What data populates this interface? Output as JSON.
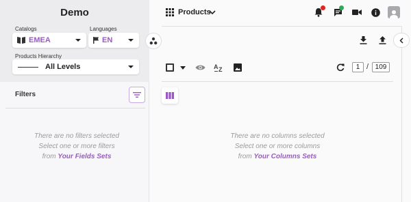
{
  "app": {
    "title": "Demo"
  },
  "catalogs": {
    "label": "Catalogs",
    "value": "EMEA"
  },
  "languages": {
    "label": "Languages",
    "value": "EN"
  },
  "hierarchy": {
    "label": "Products Hierarchy",
    "value": "All Levels"
  },
  "filters": {
    "label": "Filters",
    "empty_line1": "There are no filters selected",
    "empty_line2": "Select one or more filters",
    "empty_prefix": "from",
    "empty_link": "Your Fields Sets"
  },
  "header": {
    "products_label": "Products",
    "notification_badge_color": "#e02424",
    "chat_badge_color": "#2eaa5a"
  },
  "pagination": {
    "current": "1",
    "separator": "/",
    "total": "109"
  },
  "columns": {
    "empty_line1": "There are no columns selected",
    "empty_line2": "Select one or more columns",
    "empty_prefix": "from",
    "empty_link": "Your Columns Sets"
  },
  "colors": {
    "accent": "#9b59c8",
    "muted_text": "#9a9a9a"
  },
  "icons": [
    "apps-grid-icon",
    "chevron-down-icon",
    "bell-icon",
    "chat-icon",
    "video-icon",
    "info-icon",
    "user-icon",
    "download-icon",
    "upload-icon",
    "chevron-left-icon",
    "checkbox-icon",
    "caret-down-icon",
    "eye-icon",
    "sort-az-icon",
    "image-icon",
    "refresh-icon",
    "columns-icon",
    "filter-icon",
    "hierarchy-icon",
    "book-icon",
    "flag-icon"
  ]
}
